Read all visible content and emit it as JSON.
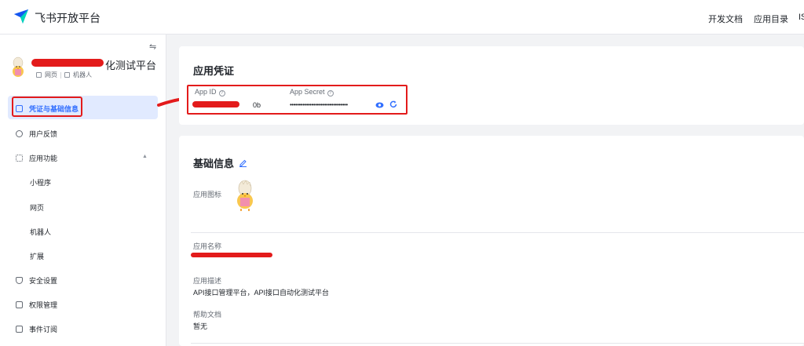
{
  "topbar": {
    "brand": "飞书开放平台",
    "nav": [
      "开发文档",
      "应用目录",
      "IS"
    ]
  },
  "sidebar": {
    "collapse_icon": "⇋",
    "app_name_suffix": "化测试平台",
    "tags": [
      "网页",
      "机器人"
    ],
    "items": [
      {
        "label": "凭证与基础信息",
        "icon": "doc-icon"
      },
      {
        "label": "用户反馈",
        "icon": "feedback-icon"
      },
      {
        "label": "应用功能",
        "icon": "grid-icon"
      },
      {
        "label": "小程序"
      },
      {
        "label": "网页"
      },
      {
        "label": "机器人"
      },
      {
        "label": "扩展"
      },
      {
        "label": "安全设置",
        "icon": "shield-icon"
      },
      {
        "label": "权限管理",
        "icon": "lock-icon"
      },
      {
        "label": "事件订阅",
        "icon": "plus-square-icon"
      }
    ]
  },
  "credentials": {
    "title": "应用凭证",
    "app_id_label": "App ID",
    "app_id_value": "0b",
    "app_secret_label": "App Secret",
    "app_secret_value": "••••••••••••••••••••••••••••••••"
  },
  "basic_info": {
    "title": "基础信息",
    "icon_label": "应用图标",
    "name_label": "应用名称",
    "desc_label": "应用描述",
    "desc_value": "API接口管理平台，API接口自动化测试平台",
    "help_label": "帮助文档",
    "help_value": "暂无"
  },
  "colors": {
    "accent": "#3370ff",
    "active_bg": "#e1eaff",
    "annotation_red": "#e31b1b"
  }
}
